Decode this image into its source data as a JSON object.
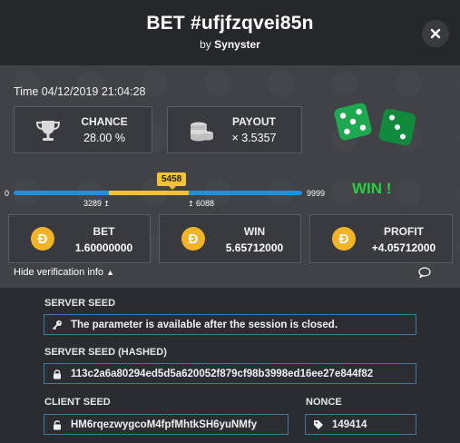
{
  "header": {
    "title": "BET #ufjfzqvei85n",
    "by_prefix": "by",
    "author": "Synyster",
    "close_icon": "close-icon"
  },
  "time": "Time 04/12/2019 21:04:28",
  "chance": {
    "label": "CHANCE",
    "value": "28.00 %",
    "icon": "trophy-icon"
  },
  "payout": {
    "label": "PAYOUT",
    "value": "× 3.5357",
    "icon": "coins-stack-icon"
  },
  "dice": {
    "icon": "dice-icon",
    "color": "#1e9e4a"
  },
  "slider": {
    "min": "0",
    "max": "9999",
    "range_low": "3289",
    "range_high": "6088",
    "result": "5458",
    "track_color": "#1f8fde",
    "win_color": "#f4c430"
  },
  "result_text": "WIN !",
  "bet": {
    "label": "BET",
    "value": "1.60000000",
    "coin": "Ð"
  },
  "win": {
    "label": "WIN",
    "value": "5.65712000",
    "coin": "Ð"
  },
  "profit": {
    "label": "PROFIT",
    "value": "+4.05712000",
    "coin": "Ð"
  },
  "verification_toggle": "Hide verification info",
  "server_seed": {
    "label": "SERVER SEED",
    "value": "The parameter is available after the session is closed."
  },
  "server_seed_hashed": {
    "label": "SERVER SEED (HASHED)",
    "value": "113c2a6a80294ed5d5a620052f879cf98b3998ed16ee27e844f82"
  },
  "client_seed": {
    "label": "CLIENT SEED",
    "value": "HM6rqezwygcoM4fpfMhtkSH6yuNMfy"
  },
  "nonce": {
    "label": "NONCE",
    "value": "149414"
  }
}
